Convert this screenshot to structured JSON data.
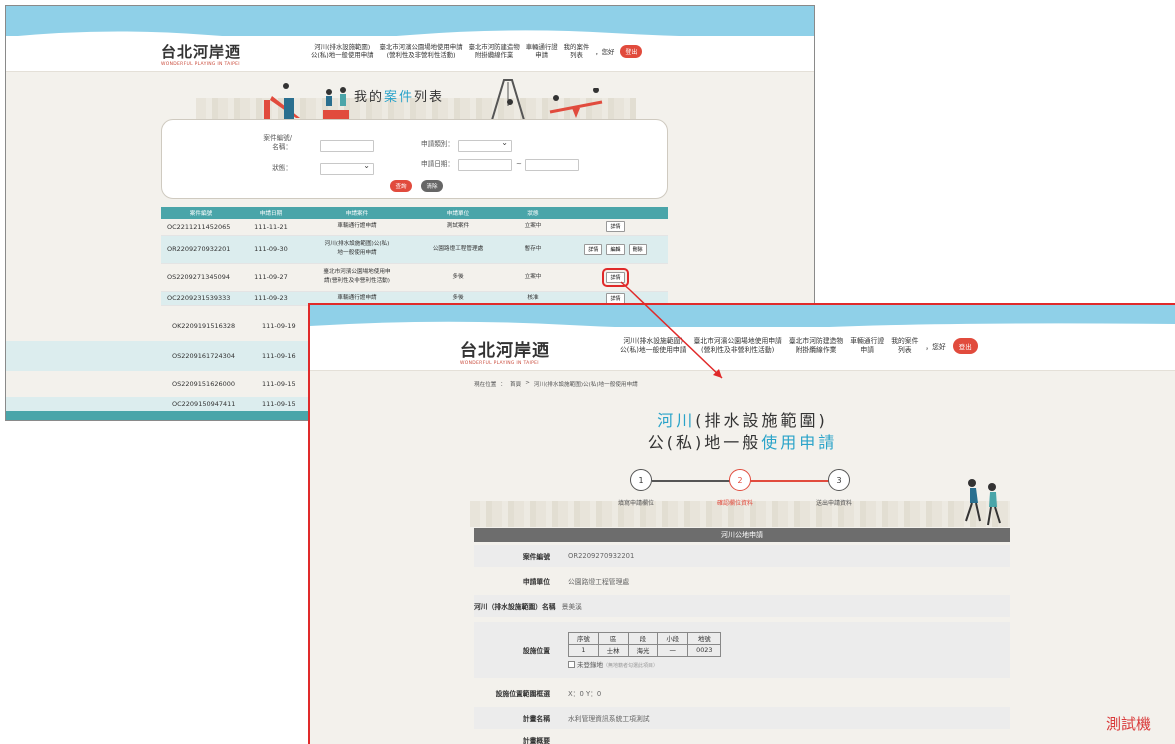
{
  "brand": {
    "logo_text": "台北河岸迺",
    "logo_sub": "WONDERFUL PLAYING IN TAIPEI"
  },
  "nav": {
    "items": [
      {
        "line1": "河川(排水設施範圍)",
        "line2": "公(私)地一般使用申請"
      },
      {
        "line1": "臺北市河濱公園場地使用申請",
        "line2": "(營利性及非營利性活動)"
      },
      {
        "line1": "臺北市河防建造物",
        "line2": "附掛纜線作業"
      },
      {
        "line1": "車輛通行證",
        "line2": "申請"
      },
      {
        "line1": "我的案件",
        "line2": "列表"
      }
    ],
    "greeting": "，您好",
    "logout": "登出"
  },
  "list_page": {
    "title_prefix": "我的",
    "title_highlight": "案件",
    "title_suffix": "列表",
    "search": {
      "case_no_label": "案件編號/",
      "case_no_label2": "名稱：",
      "type_label": "申請類別：",
      "status_label": "狀態：",
      "date_label": "申請日期：",
      "date_sep": "~",
      "query_button": "查詢",
      "clear_button": "清除"
    },
    "columns": [
      "案件編號",
      "申請日期",
      "申請案件",
      "申請單位",
      "狀態",
      ""
    ],
    "rows": [
      {
        "id": "OC2211211452065",
        "date": "111-11-21",
        "case": "車輛通行證申請",
        "case2": "",
        "unit": "測試案件",
        "status": "立案中",
        "actions": [
          "詳情"
        ]
      },
      {
        "id": "OR2209270932201",
        "date": "111-09-30",
        "case": "河川(排水設施範圍)公(私)",
        "case2": "地一般使用申請",
        "unit": "公園路燈工程管理處",
        "status": "暫存中",
        "actions": [
          "詳情",
          "編輯",
          "刪除"
        ]
      },
      {
        "id": "OS2209271345094",
        "date": "111-09-27",
        "case": "臺北市河濱公園場地使用申",
        "case2": "請(營利性及非營利性活動)",
        "unit": "多後",
        "status": "立案中",
        "actions": [
          "詳情"
        ]
      },
      {
        "id": "OC2209231539333",
        "date": "111-09-23",
        "case": "車輛通行證申請",
        "case2": "",
        "unit": "多後",
        "status": "核准",
        "actions": [
          "詳情"
        ]
      }
    ],
    "more_rows": [
      {
        "id": "OK2209191516328",
        "date": "111-09-19"
      },
      {
        "id": "OS2209161724304",
        "date": "111-09-16"
      },
      {
        "id": "OS2209151626000",
        "date": "111-09-15"
      },
      {
        "id": "OC2209150947411",
        "date": "111-09-15"
      }
    ]
  },
  "detail_page": {
    "breadcrumb": [
      "現在位置",
      "：",
      "首頁",
      ">",
      "河川(排水設施範圍)公(私)地一般使用申請"
    ],
    "title_line1_hl": "河川",
    "title_line1_rest": "(排水設施範圍)",
    "title_line2_rest": "公(私)地一般",
    "title_line2_hl": "使用申請",
    "steps": [
      {
        "num": "1",
        "label": "填寫申請欄位"
      },
      {
        "num": "2",
        "label": "確認欄位資料"
      },
      {
        "num": "3",
        "label": "送出申請資料"
      }
    ],
    "section_title": "河川公地申請",
    "fields": {
      "case_no_label": "案件編號",
      "case_no_value": "OR2209270932201",
      "unit_label": "申請單位",
      "unit_value": "公園路燈工程管理處",
      "river_label": "河川（排水設施範圍）名稱",
      "river_value": "景美溪",
      "location_label": "設施位置",
      "location_cols": [
        "序號",
        "區",
        "段",
        "小段",
        "地號"
      ],
      "location_row": [
        "1",
        "士林",
        "海光",
        "一",
        "0023"
      ],
      "unregistered_label": "未登錄地",
      "unregistered_note": "（無地籍者勾選此項目）",
      "coord_label": "設施位置範圍框選",
      "coord_value": "X：0 Y：0",
      "plan_label": "計畫名稱",
      "plan_value": "水利管理資訊系統工項測試",
      "summary_label": "計畫概要"
    }
  },
  "watermark": "測試機",
  "colors": {
    "accent_blue": "#2aa3c9",
    "teal_header": "#4aa5a9",
    "red": "#e02a2a",
    "logout": "#e14b3d"
  }
}
